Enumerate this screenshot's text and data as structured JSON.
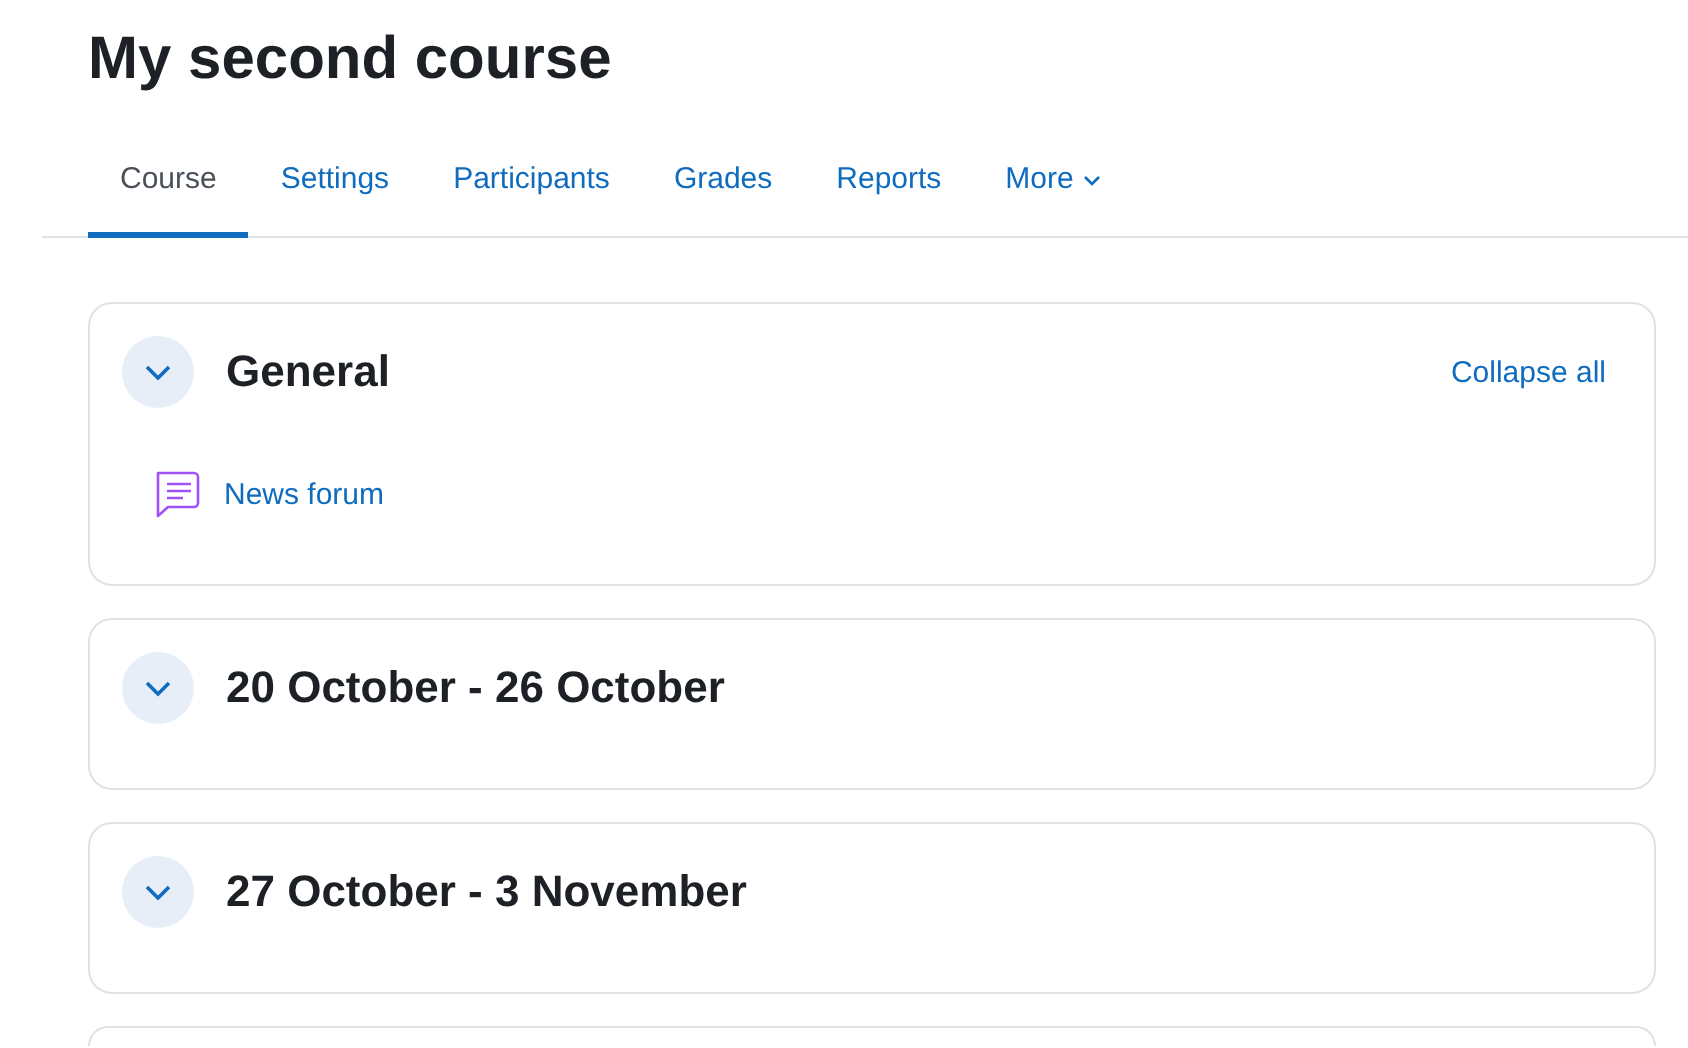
{
  "course": {
    "title": "My second course"
  },
  "tabs": [
    {
      "label": "Course",
      "selected": true,
      "kind": "link"
    },
    {
      "label": "Settings",
      "selected": false,
      "kind": "link"
    },
    {
      "label": "Participants",
      "selected": false,
      "kind": "link"
    },
    {
      "label": "Grades",
      "selected": false,
      "kind": "link"
    },
    {
      "label": "Reports",
      "selected": false,
      "kind": "link"
    },
    {
      "label": "More",
      "selected": false,
      "kind": "menu"
    }
  ],
  "collapse_all": "Collapse all",
  "sections": [
    {
      "title": "General",
      "expanded": true,
      "activities": [
        {
          "name": "News forum",
          "kind": "forum"
        }
      ]
    },
    {
      "title": "20 October - 26 October",
      "expanded": true
    },
    {
      "title": "27 October - 3 November",
      "expanded": true
    }
  ]
}
